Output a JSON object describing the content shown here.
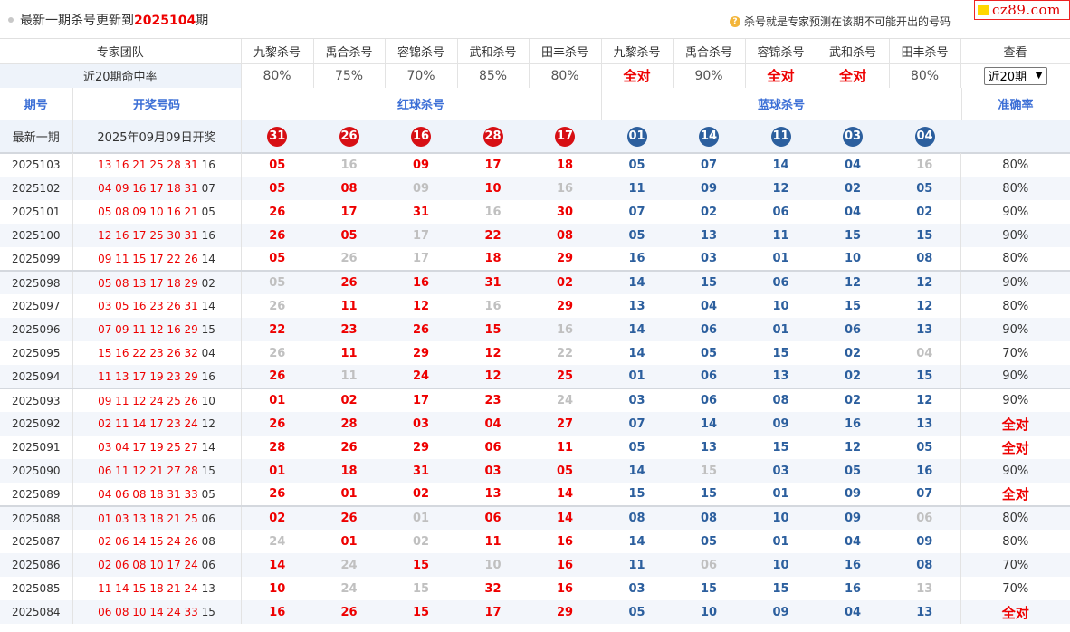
{
  "header": {
    "title_prefix": "最新一期杀号更新到",
    "title_issue": "2025104",
    "title_suffix": "期",
    "hint": "杀号就是专家预测在该期不可能开出的号码",
    "logo": "cz89.com"
  },
  "experts": {
    "team_label": "专家团队",
    "rate_label": "近20期命中率",
    "view_label": "查看",
    "names": [
      "九黎杀号",
      "禹合杀号",
      "容锦杀号",
      "武和杀号",
      "田丰杀号",
      "九黎杀号",
      "禹合杀号",
      "容锦杀号",
      "武和杀号",
      "田丰杀号"
    ],
    "rates": [
      "80%",
      "75%",
      "70%",
      "85%",
      "80%",
      "全对",
      "90%",
      "全对",
      "全对",
      "80%"
    ],
    "period_select": "近20期"
  },
  "sections": {
    "issue": "期号",
    "draw": "开奖号码",
    "red": "红球杀号",
    "blue": "蓝球杀号",
    "accuracy": "准确率"
  },
  "latest": {
    "issue": "最新一期",
    "draw": "2025年09月09日开奖",
    "red": [
      "31",
      "26",
      "16",
      "28",
      "17"
    ],
    "blue": [
      "01",
      "14",
      "11",
      "03",
      "04"
    ]
  },
  "rows": [
    {
      "issue": "2025103",
      "reds": "13 16 21 25 28 31",
      "blue": "16",
      "kills": [
        "05",
        "16",
        "09",
        "17",
        "18",
        "05",
        "07",
        "14",
        "04",
        "16"
      ],
      "miss": [
        1,
        9
      ],
      "acc": "80%"
    },
    {
      "issue": "2025102",
      "reds": "04 09 16 17 18 31",
      "blue": "07",
      "kills": [
        "05",
        "08",
        "09",
        "10",
        "16",
        "11",
        "09",
        "12",
        "02",
        "05"
      ],
      "miss": [
        2,
        4
      ],
      "acc": "80%"
    },
    {
      "issue": "2025101",
      "reds": "05 08 09 10 16 21",
      "blue": "05",
      "kills": [
        "26",
        "17",
        "31",
        "16",
        "30",
        "07",
        "02",
        "06",
        "04",
        "02"
      ],
      "miss": [
        3
      ],
      "acc": "90%"
    },
    {
      "issue": "2025100",
      "reds": "12 16 17 25 30 31",
      "blue": "16",
      "kills": [
        "26",
        "05",
        "17",
        "22",
        "08",
        "05",
        "13",
        "11",
        "15",
        "15"
      ],
      "miss": [
        2
      ],
      "acc": "90%"
    },
    {
      "issue": "2025099",
      "reds": "09 11 15 17 22 26",
      "blue": "14",
      "kills": [
        "05",
        "26",
        "17",
        "18",
        "29",
        "16",
        "03",
        "01",
        "10",
        "08"
      ],
      "miss": [
        1,
        2
      ],
      "acc": "80%"
    },
    {
      "issue": "2025098",
      "reds": "05 08 13 17 18 29",
      "blue": "02",
      "kills": [
        "05",
        "26",
        "16",
        "31",
        "02",
        "14",
        "15",
        "06",
        "12",
        "12"
      ],
      "miss": [
        0
      ],
      "acc": "90%"
    },
    {
      "issue": "2025097",
      "reds": "03 05 16 23 26 31",
      "blue": "14",
      "kills": [
        "26",
        "11",
        "12",
        "16",
        "29",
        "13",
        "04",
        "10",
        "15",
        "12"
      ],
      "miss": [
        0,
        3
      ],
      "acc": "80%"
    },
    {
      "issue": "2025096",
      "reds": "07 09 11 12 16 29",
      "blue": "15",
      "kills": [
        "22",
        "23",
        "26",
        "15",
        "16",
        "14",
        "06",
        "01",
        "06",
        "13"
      ],
      "miss": [
        4
      ],
      "acc": "90%"
    },
    {
      "issue": "2025095",
      "reds": "15 16 22 23 26 32",
      "blue": "04",
      "kills": [
        "26",
        "11",
        "29",
        "12",
        "22",
        "14",
        "05",
        "15",
        "02",
        "04"
      ],
      "miss": [
        0,
        4,
        9
      ],
      "acc": "70%"
    },
    {
      "issue": "2025094",
      "reds": "11 13 17 19 23 29",
      "blue": "16",
      "kills": [
        "26",
        "11",
        "24",
        "12",
        "25",
        "01",
        "06",
        "13",
        "02",
        "15"
      ],
      "miss": [
        1
      ],
      "acc": "90%"
    },
    {
      "issue": "2025093",
      "reds": "09 11 12 24 25 26",
      "blue": "10",
      "kills": [
        "01",
        "02",
        "17",
        "23",
        "24",
        "03",
        "06",
        "08",
        "02",
        "12"
      ],
      "miss": [
        4
      ],
      "acc": "90%"
    },
    {
      "issue": "2025092",
      "reds": "02 11 14 17 23 24",
      "blue": "12",
      "kills": [
        "26",
        "28",
        "03",
        "04",
        "27",
        "07",
        "14",
        "09",
        "16",
        "13"
      ],
      "miss": [],
      "acc": "全对"
    },
    {
      "issue": "2025091",
      "reds": "03 04 17 19 25 27",
      "blue": "14",
      "kills": [
        "28",
        "26",
        "29",
        "06",
        "11",
        "05",
        "13",
        "15",
        "12",
        "05"
      ],
      "miss": [],
      "acc": "全对"
    },
    {
      "issue": "2025090",
      "reds": "06 11 12 21 27 28",
      "blue": "15",
      "kills": [
        "01",
        "18",
        "31",
        "03",
        "05",
        "14",
        "15",
        "03",
        "05",
        "16"
      ],
      "miss": [
        6
      ],
      "acc": "90%"
    },
    {
      "issue": "2025089",
      "reds": "04 06 08 18 31 33",
      "blue": "05",
      "kills": [
        "26",
        "01",
        "02",
        "13",
        "14",
        "15",
        "15",
        "01",
        "09",
        "07"
      ],
      "miss": [],
      "acc": "全对"
    },
    {
      "issue": "2025088",
      "reds": "01 03 13 18 21 25",
      "blue": "06",
      "kills": [
        "02",
        "26",
        "01",
        "06",
        "14",
        "08",
        "08",
        "10",
        "09",
        "06"
      ],
      "miss": [
        2,
        9
      ],
      "acc": "80%"
    },
    {
      "issue": "2025087",
      "reds": "02 06 14 15 24 26",
      "blue": "08",
      "kills": [
        "24",
        "01",
        "02",
        "11",
        "16",
        "14",
        "05",
        "01",
        "04",
        "09"
      ],
      "miss": [
        0,
        2
      ],
      "acc": "80%"
    },
    {
      "issue": "2025086",
      "reds": "02 06 08 10 17 24",
      "blue": "06",
      "kills": [
        "14",
        "24",
        "15",
        "10",
        "16",
        "11",
        "06",
        "10",
        "16",
        "08"
      ],
      "miss": [
        1,
        3,
        6
      ],
      "acc": "70%"
    },
    {
      "issue": "2025085",
      "reds": "11 14 15 18 21 24",
      "blue": "13",
      "kills": [
        "10",
        "24",
        "15",
        "32",
        "16",
        "03",
        "15",
        "15",
        "16",
        "13"
      ],
      "miss": [
        1,
        2,
        9
      ],
      "acc": "70%"
    },
    {
      "issue": "2025084",
      "reds": "06 08 10 14 24 33",
      "blue": "15",
      "kills": [
        "16",
        "26",
        "15",
        "17",
        "29",
        "05",
        "10",
        "09",
        "04",
        "13"
      ],
      "miss": [],
      "acc": "全对"
    }
  ]
}
